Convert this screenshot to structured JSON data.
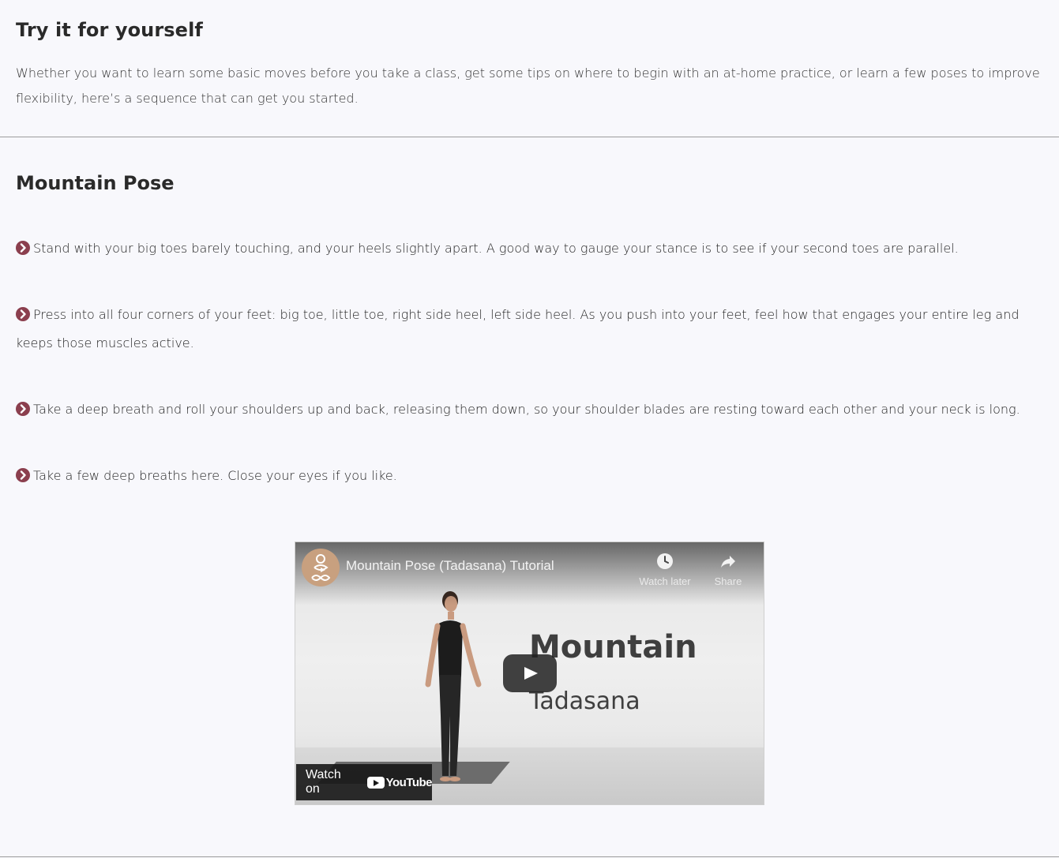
{
  "intro": {
    "title": "Try it for yourself",
    "text": "Whether you want to learn some basic moves before you take a class, get some tips on where to begin with an at-home practice, or learn a few poses to improve flexibility, here’s a sequence that can get you started."
  },
  "pose": {
    "title": "Mountain Pose",
    "steps": [
      "Stand with your big toes barely touching, and your heels slightly apart. A good way to gauge your stance is to see if your second toes are parallel.",
      "Press into all four corners of your feet: big toe, little toe, right side heel, left side heel. As you push into your feet, feel how that engages your entire leg and keeps those muscles active.",
      "Take a deep breath and roll your shoulders up and back, releasing them down, so your shoulder blades are resting toward each other and your neck is long.",
      "Take a few deep breaths here. Close your eyes if you like."
    ],
    "bullet_icon": "chevron-right-circle-icon",
    "accent_color": "#8b3f4e"
  },
  "video": {
    "title": "Mountain Pose (Tadasana) Tutorial",
    "watch_later": "Watch later",
    "share": "Share",
    "overlay_title": "Mountain",
    "overlay_subtitle": "Tadasana",
    "watch_on": "Watch on",
    "platform": "YouTube"
  }
}
